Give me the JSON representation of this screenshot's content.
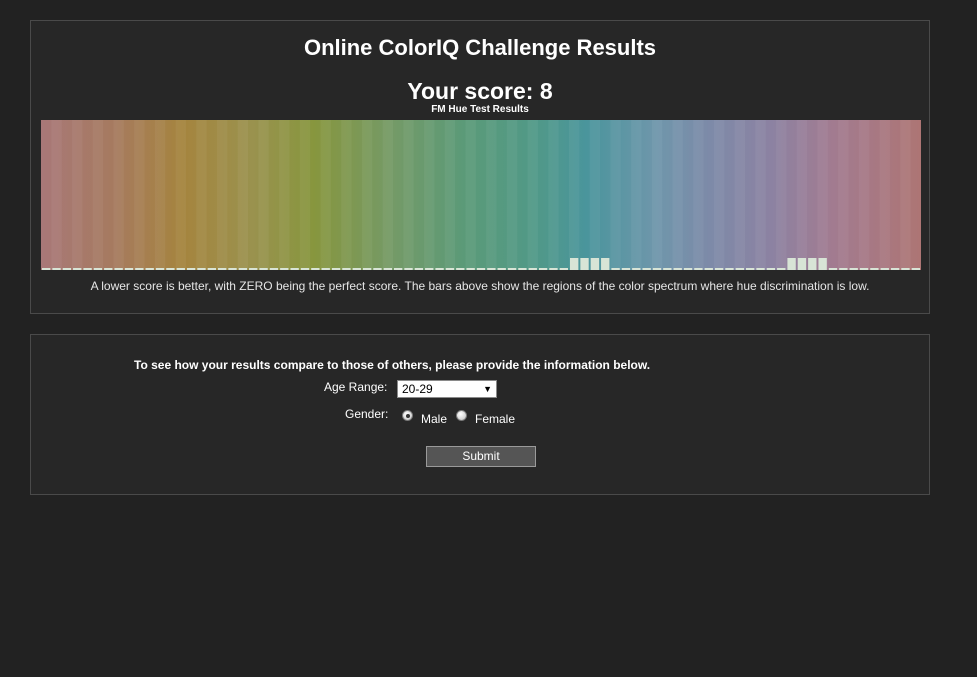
{
  "results": {
    "title": "Online ColorIQ Challenge Results",
    "score_label": "Your score: 8",
    "footnote": "A lower score is better, with ZERO being the perfect score. The bars above show the regions of the color spectrum where hue discrimination is low."
  },
  "chart_data": {
    "type": "bar",
    "title": "FM Hue Test Results",
    "bar_count": 85,
    "values": [
      0,
      0,
      0,
      0,
      0,
      0,
      0,
      0,
      0,
      0,
      0,
      0,
      0,
      0,
      0,
      0,
      0,
      0,
      0,
      0,
      0,
      0,
      0,
      0,
      0,
      0,
      0,
      0,
      0,
      0,
      0,
      0,
      0,
      0,
      0,
      0,
      0,
      0,
      0,
      0,
      0,
      0,
      0,
      0,
      0,
      0,
      0,
      0,
      0,
      0,
      0,
      1,
      1,
      1,
      1,
      0,
      0,
      0,
      0,
      0,
      0,
      0,
      0,
      0,
      0,
      0,
      0,
      0,
      0,
      0,
      0,
      0,
      1,
      1,
      1,
      1,
      0,
      0,
      0,
      0,
      0,
      0,
      0,
      0,
      0
    ],
    "ymax": 1,
    "background": "hue spectrum",
    "bar_color": "#d8e4d6"
  },
  "compare": {
    "prompt": "To see how your results compare to those of others, please provide the information below.",
    "age_label": "Age Range:",
    "age_value": "20-29",
    "gender_label": "Gender:",
    "male_label": "Male",
    "female_label": "Female",
    "selected_gender": "male",
    "submit_label": "Submit"
  }
}
